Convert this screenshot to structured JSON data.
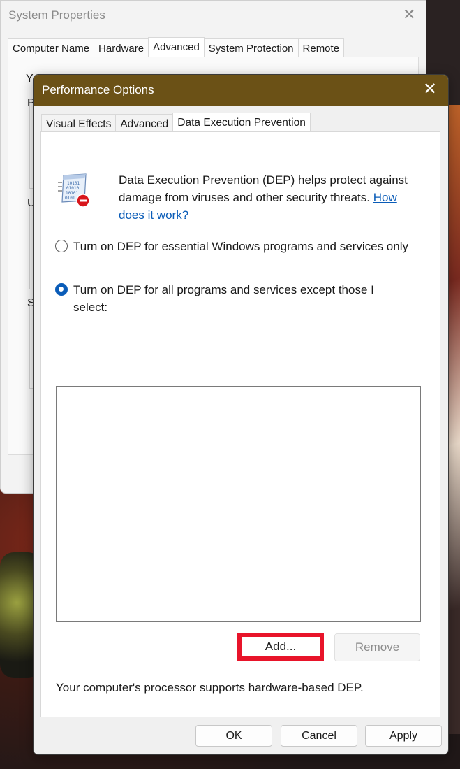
{
  "system_properties": {
    "title": "System Properties",
    "close_glyph": "✕",
    "tabs": [
      {
        "label": "Computer Name",
        "active": false
      },
      {
        "label": "Hardware",
        "active": false
      },
      {
        "label": "Advanced",
        "active": true
      },
      {
        "label": "System Protection",
        "active": false
      },
      {
        "label": "Remote",
        "active": false
      }
    ],
    "fragments": [
      "Y",
      "P",
      "U",
      "S"
    ]
  },
  "performance_options": {
    "title": "Performance Options",
    "close_glyph": "✕",
    "titlebar_color": "#6b5116",
    "tabs": [
      {
        "label": "Visual Effects",
        "active": false
      },
      {
        "label": "Advanced",
        "active": false
      },
      {
        "label": "Data Execution Prevention",
        "active": true
      }
    ],
    "dep": {
      "icon": "dep-document-icon",
      "description": "Data Execution Prevention (DEP) helps protect against damage from viruses and other security threats.",
      "link_text": "How does it work?",
      "options": [
        {
          "label": "Turn on DEP for essential Windows programs and services only",
          "selected": false
        },
        {
          "label": "Turn on DEP for all programs and services except those I select:",
          "selected": true
        }
      ],
      "programs": [],
      "add_label": "Add...",
      "remove_label": "Remove",
      "status_text": "Your computer's processor supports hardware-based DEP."
    },
    "buttons": {
      "ok": "OK",
      "cancel": "Cancel",
      "apply": "Apply"
    },
    "highlight_color": "#e8142a"
  }
}
